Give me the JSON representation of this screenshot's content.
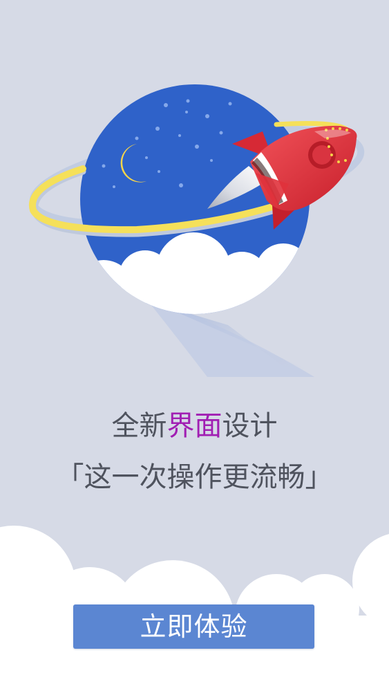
{
  "headline": {
    "prefix": "全新",
    "highlight": "界面",
    "suffix": "设计"
  },
  "subline": {
    "text": "「这一次操作更流畅」"
  },
  "cta": {
    "label": "立即体验"
  },
  "illustration": {
    "icon": "rocket-planet-illustration",
    "planet_color": "#2f62c9",
    "ring_color": "#f5e05a",
    "rocket_color": "#e0323c"
  },
  "colors": {
    "background": "#d6dae6",
    "text": "#4f535e",
    "accent": "#a11fb3",
    "button": "#5b86d2"
  }
}
